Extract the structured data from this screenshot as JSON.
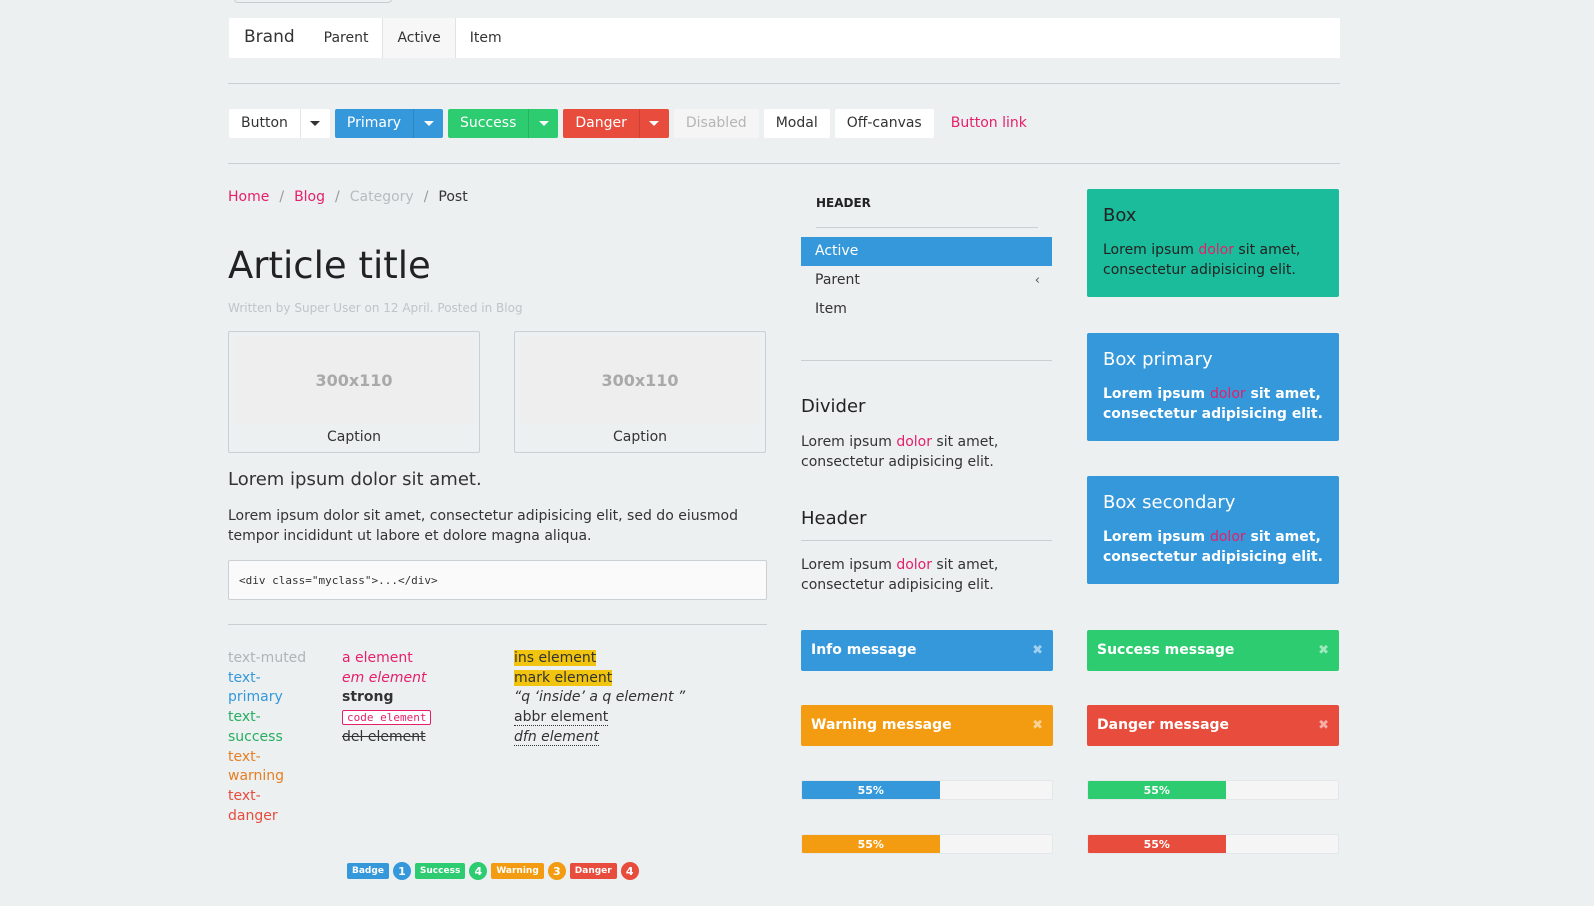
{
  "navbar": {
    "brand": "Brand",
    "items": [
      {
        "label": "Parent",
        "active": false
      },
      {
        "label": "Active",
        "active": true
      },
      {
        "label": "Item",
        "active": false
      }
    ]
  },
  "buttons": {
    "default": "Button",
    "primary": "Primary",
    "success": "Success",
    "danger": "Danger",
    "disabled": "Disabled",
    "modal": "Modal",
    "offcanvas": "Off-canvas",
    "link": "Button link"
  },
  "breadcrumb": {
    "home": "Home",
    "blog": "Blog",
    "category": "Category",
    "post": "Post",
    "separator": "/"
  },
  "article": {
    "title": "Article title",
    "meta": "Written by Super User on 12 April. Posted in Blog",
    "thumbs": [
      {
        "placeholder": "300x110",
        "caption": "Caption"
      },
      {
        "placeholder": "300x110",
        "caption": "Caption"
      }
    ],
    "lead": "Lorem ipsum dolor sit amet.",
    "paragraph": "Lorem ipsum dolor sit amet, consectetur adipisicing elit, sed do eiusmod tempor incididunt ut labore et dolore magna aliqua.",
    "code": "<div class=\"myclass\">...</div>"
  },
  "text_colors": {
    "muted": "text-muted",
    "primary": "text-primary",
    "success": "text-success",
    "warning": "text-warning",
    "danger": "text-danger"
  },
  "elements_col1": {
    "a": "a element",
    "em": "em element",
    "strong": "strong",
    "code": "code element",
    "del": "del element"
  },
  "elements_col2": {
    "ins": "ins element",
    "mark": "mark element",
    "q": "“q ‘inside’ a q element ”",
    "abbr": "abbr element",
    "dfn": "dfn element"
  },
  "badges": [
    {
      "label": "Badge",
      "color": "#3498db"
    },
    {
      "label": "1",
      "color": "#3498db",
      "round": true
    },
    {
      "label": "Success",
      "color": "#2ecc71"
    },
    {
      "label": "4",
      "color": "#2ecc71",
      "round": true
    },
    {
      "label": "Warning",
      "color": "#f39c12"
    },
    {
      "label": "3",
      "color": "#f39c12",
      "round": true
    },
    {
      "label": "Danger",
      "color": "#e74c3c"
    },
    {
      "label": "4",
      "color": "#e74c3c",
      "round": true
    }
  ],
  "sidenav": {
    "header": "HEADER",
    "items": [
      {
        "label": "Active",
        "active": true
      },
      {
        "label": "Parent",
        "chevron": "‹"
      },
      {
        "label": "Item"
      }
    ]
  },
  "panels": {
    "divider_title": "Divider",
    "header_title": "Header",
    "text_pre": "Lorem ipsum ",
    "text_hl": "dolor",
    "text_post": " sit amet, consectetur adipisicing elit."
  },
  "boxes": [
    {
      "title": "Box"
    },
    {
      "title": "Box primary"
    },
    {
      "title": "Box secondary"
    }
  ],
  "box_text": {
    "pre": "Lorem ipsum ",
    "hl": "dolor",
    "post": " sit amet, consectetur adipisicing elit."
  },
  "alerts": {
    "info": "Info message",
    "success": "Success message",
    "warning": "Warning message",
    "danger": "Danger message",
    "close": "✖"
  },
  "progress": {
    "value_percent": 55,
    "label": "55%"
  },
  "colors": {
    "primary": "#3498db",
    "success": "#2ecc71",
    "warning": "#f39c12",
    "danger": "#e74c3c",
    "link": "#e51f6a",
    "box": "#1abc9c"
  }
}
